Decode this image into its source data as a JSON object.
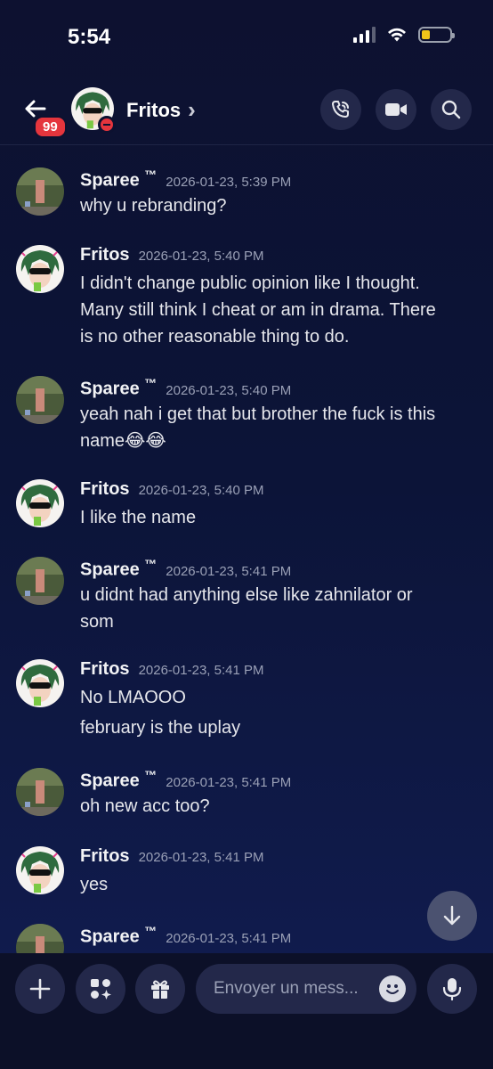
{
  "status_bar": {
    "time": "5:54",
    "battery_level": 0.25
  },
  "header": {
    "unread_badge": "99",
    "channel_name": "Fritos",
    "chevron": "›",
    "icons": [
      "back-arrow-icon",
      "phone-call-icon",
      "video-camera-icon",
      "search-icon"
    ]
  },
  "messages": [
    {
      "author": "Sparee",
      "tm": "™",
      "timestamp": "2026-01-23, 5:39 PM",
      "lines": [
        "why u rebranding?"
      ]
    },
    {
      "author": "Fritos",
      "timestamp": "2026-01-23, 5:40 PM",
      "lines": [
        "I didn't change public opinion like I thought.",
        "Many still think I cheat or am in drama. There",
        "is no other reasonable thing to do."
      ]
    },
    {
      "author": "Sparee",
      "tm": "™",
      "timestamp": "2026-01-23, 5:40 PM",
      "lines": [
        "yeah nah i get that but brother the fuck is this",
        "name😂😂"
      ]
    },
    {
      "author": "Fritos",
      "timestamp": "2026-01-23, 5:40 PM",
      "lines": [
        "I like the name"
      ]
    },
    {
      "author": "Sparee",
      "tm": "™",
      "timestamp": "2026-01-23, 5:41 PM",
      "lines": [
        "u didnt had anything else like zahnilator or",
        "som"
      ]
    },
    {
      "author": "Fritos",
      "timestamp": "2026-01-23, 5:41 PM",
      "lines": [
        "No LMAOOO"
      ],
      "followup": "february is the uplay"
    },
    {
      "author": "Sparee",
      "tm": "™",
      "timestamp": "2026-01-23, 5:41 PM",
      "lines": [
        "oh new acc too?"
      ]
    },
    {
      "author": "Fritos",
      "timestamp": "2026-01-23, 5:41 PM",
      "lines": [
        "yes"
      ]
    },
    {
      "author": "Sparee",
      "tm": "™",
      "timestamp": "2026-01-23, 5:41 PM",
      "lines": []
    }
  ],
  "composer": {
    "placeholder": "Envoyer un mess...",
    "icons": [
      "plus-icon",
      "apps-icon",
      "gift-icon",
      "emoji-icon",
      "microphone-icon"
    ]
  }
}
